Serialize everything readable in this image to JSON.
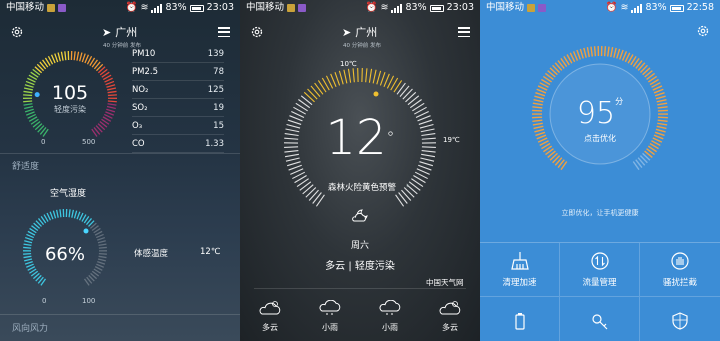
{
  "status_bars": [
    {
      "carrier": "中国移动",
      "battery": "83%",
      "time": "23:03"
    },
    {
      "carrier": "中国移动",
      "battery": "83%",
      "time": "23:03"
    },
    {
      "carrier": "中国移动",
      "battery": "83%",
      "time": "22:58"
    }
  ],
  "air": {
    "city": "广州",
    "publish_time": "40 分钟前 发布",
    "aqi": "105",
    "aqi_level": "轻度污染",
    "aqi_min": "0",
    "aqi_max": "500",
    "aqi_fraction": 0.21,
    "pollutants": [
      {
        "name": "PM10",
        "value": "139"
      },
      {
        "name": "PM2.5",
        "value": "78"
      },
      {
        "name": "NO₂",
        "value": "125"
      },
      {
        "name": "SO₂",
        "value": "19"
      },
      {
        "name": "O₃",
        "value": "15"
      },
      {
        "name": "CO",
        "value": "1.33"
      }
    ],
    "comfort_section": "舒适度",
    "humidity_label": "空气湿度",
    "humidity": "66%",
    "humidity_min": "0",
    "humidity_max": "100",
    "humidity_fraction": 0.66,
    "feels_label": "体感温度",
    "feels_value": "12℃",
    "wind_section": "风向风力"
  },
  "weather": {
    "city": "广州",
    "publish_time": "40 分钟前 发布",
    "temp": "12",
    "degree": "°",
    "low": "10℃",
    "high": "19℃",
    "alert": "森林火险黄色预警",
    "weekday": "周六",
    "condition": "多云",
    "air_quality": "轻度污染",
    "separator": "|",
    "source": "中国天气网",
    "forecast": [
      {
        "icon": "cloudy-icon",
        "label": "多云"
      },
      {
        "icon": "light-rain-icon",
        "label": "小雨"
      },
      {
        "icon": "light-rain-icon",
        "label": "小雨"
      },
      {
        "icon": "cloudy-icon",
        "label": "多云"
      }
    ]
  },
  "cleaner": {
    "score": "95",
    "unit": "分",
    "action": "点击优化",
    "tip": "立即优化，让手机更健康",
    "score_fraction": 0.95,
    "tiles": [
      {
        "icon": "broom-icon",
        "label": "清理加速"
      },
      {
        "icon": "traffic-icon",
        "label": "流量管理"
      },
      {
        "icon": "hand-stop-icon",
        "label": "骚扰拦截"
      },
      {
        "icon": "battery-icon",
        "label": ""
      },
      {
        "icon": "key-icon",
        "label": ""
      },
      {
        "icon": "shield-icon",
        "label": ""
      }
    ]
  },
  "colors": {
    "left_bg": "#243444",
    "right_bg": "#3c8dd6",
    "warm_accent": "#f0c030",
    "score_ring": "#f0a040"
  }
}
